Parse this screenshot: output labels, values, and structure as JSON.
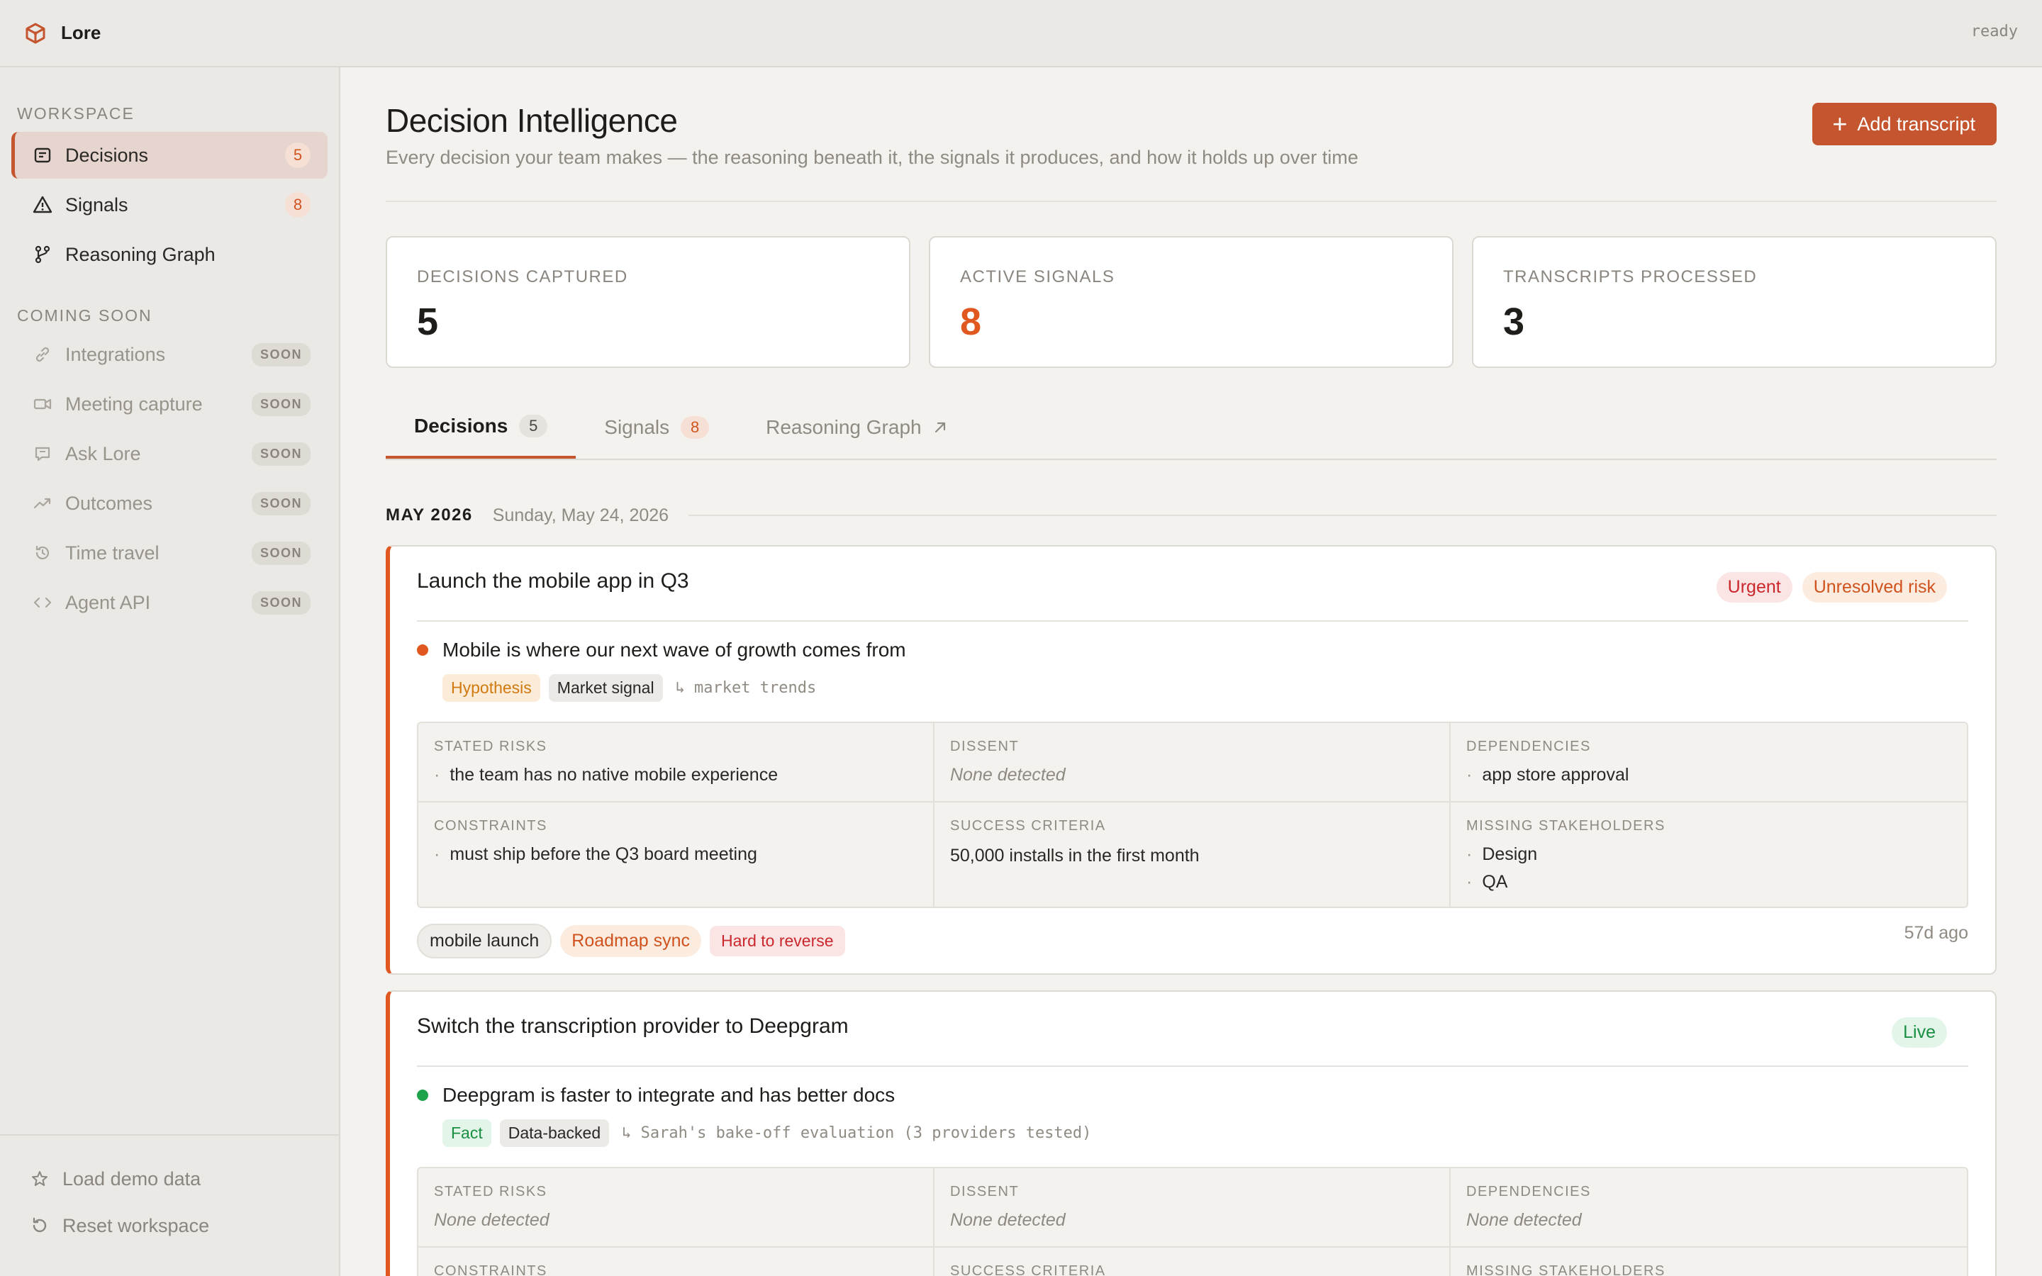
{
  "app": {
    "name": "Lore",
    "status": "ready"
  },
  "sidebar": {
    "workspace_label": "WORKSPACE",
    "items": [
      {
        "label": "Decisions",
        "count": "5",
        "icon": "list-icon"
      },
      {
        "label": "Signals",
        "count": "8",
        "icon": "warning-icon"
      },
      {
        "label": "Reasoning Graph",
        "icon": "graph-icon"
      }
    ],
    "coming_soon_label": "COMING SOON",
    "soon_items": [
      {
        "label": "Integrations",
        "badge": "SOON",
        "icon": "link-icon"
      },
      {
        "label": "Meeting capture",
        "badge": "SOON",
        "icon": "video-icon"
      },
      {
        "label": "Ask Lore",
        "badge": "SOON",
        "icon": "chat-icon"
      },
      {
        "label": "Outcomes",
        "badge": "SOON",
        "icon": "trend-icon"
      },
      {
        "label": "Time travel",
        "badge": "SOON",
        "icon": "history-icon"
      },
      {
        "label": "Agent API",
        "badge": "SOON",
        "icon": "code-icon"
      }
    ],
    "footer": {
      "load_demo": "Load demo data",
      "reset": "Reset workspace"
    }
  },
  "header": {
    "title": "Decision Intelligence",
    "subtitle": "Every decision your team makes — the reasoning beneath it, the signals it produces, and how it holds up over time",
    "add_button": "Add transcript"
  },
  "stats": [
    {
      "label": "DECISIONS CAPTURED",
      "value": "5"
    },
    {
      "label": "ACTIVE SIGNALS",
      "value": "8"
    },
    {
      "label": "TRANSCRIPTS PROCESSED",
      "value": "3"
    }
  ],
  "tabs": [
    {
      "label": "Decisions",
      "count": "5"
    },
    {
      "label": "Signals",
      "count": "8"
    },
    {
      "label": "Reasoning Graph"
    }
  ],
  "date_group": {
    "month": "MAY 2026",
    "date": "Sunday, May 24, 2026"
  },
  "decisions": [
    {
      "title": "Launch the mobile app in Q3",
      "badges": [
        "Urgent",
        "Unresolved risk"
      ],
      "premise": "Mobile is where our next wave of growth comes from",
      "premise_type": "Hypothesis",
      "premise_basis": "Market signal",
      "premise_source": "↳ market trends",
      "labels": {
        "stated_risks": "STATED RISKS",
        "dissent": "DISSENT",
        "dependencies": "DEPENDENCIES",
        "constraints": "CONSTRAINTS",
        "success_criteria": "SUCCESS CRITERIA",
        "missing_stakeholders": "MISSING STAKEHOLDERS"
      },
      "stated_risks": [
        "the team has no native mobile experience"
      ],
      "dissent": "None detected",
      "dependencies": [
        "app store approval"
      ],
      "constraints": [
        "must ship before the Q3 board meeting"
      ],
      "success_criteria": "50,000 installs in the first month",
      "missing_stakeholders": [
        "Design",
        "QA"
      ],
      "tags": [
        "mobile launch",
        "Roadmap sync",
        "Hard to reverse"
      ],
      "ago": "57d ago"
    },
    {
      "title": "Switch the transcription provider to Deepgram",
      "badges": [
        "Live"
      ],
      "premise": "Deepgram is faster to integrate and has better docs",
      "premise_type": "Fact",
      "premise_basis": "Data-backed",
      "premise_source": "↳ Sarah's bake-off evaluation (3 providers tested)",
      "labels": {
        "stated_risks": "STATED RISKS",
        "dissent": "DISSENT",
        "dependencies": "DEPENDENCIES",
        "constraints": "CONSTRAINTS",
        "success_criteria": "SUCCESS CRITERIA",
        "missing_stakeholders": "MISSING STAKEHOLDERS"
      },
      "stated_risks": "None detected",
      "dissent": "None detected",
      "dependencies": "None detected"
    }
  ],
  "colors": {
    "accent": "#c4552f",
    "signal": "#e0581f",
    "success": "#1fa34a",
    "danger": "#c9282d"
  }
}
